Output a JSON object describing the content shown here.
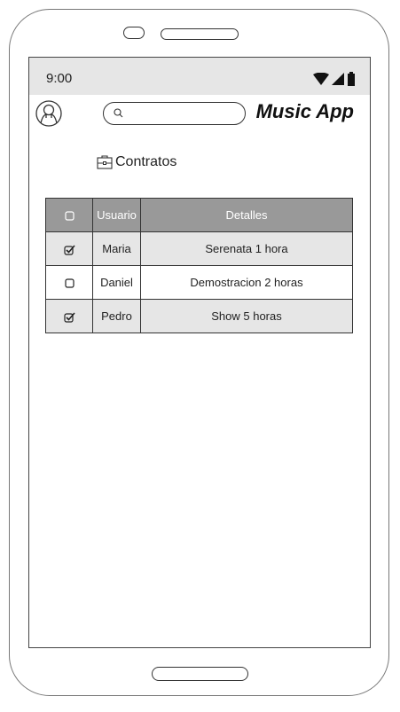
{
  "status_bar": {
    "time": "9:00",
    "icons": [
      "wifi-icon",
      "signal-icon",
      "battery-icon"
    ]
  },
  "header": {
    "app_title": "Music App",
    "search": {
      "value": "",
      "placeholder": ""
    },
    "avatar_icon": "user-avatar-icon",
    "search_icon": "search-icon"
  },
  "section": {
    "icon": "briefcase-icon",
    "title": "Contratos"
  },
  "table": {
    "columns": [
      "",
      "Usuario",
      "Detalles"
    ],
    "header_checkbox_checked": false,
    "rows": [
      {
        "checked": true,
        "usuario": "Maria",
        "detalles": "Serenata 1 hora"
      },
      {
        "checked": false,
        "usuario": "Daniel",
        "detalles": "Demostracion 2 horas"
      },
      {
        "checked": true,
        "usuario": "Pedro",
        "detalles": "Show 5 horas"
      }
    ]
  },
  "colors": {
    "status_bar_bg": "#e6e6e6",
    "table_header_bg": "#999999",
    "table_shaded_row_bg": "#e6e6e6"
  }
}
